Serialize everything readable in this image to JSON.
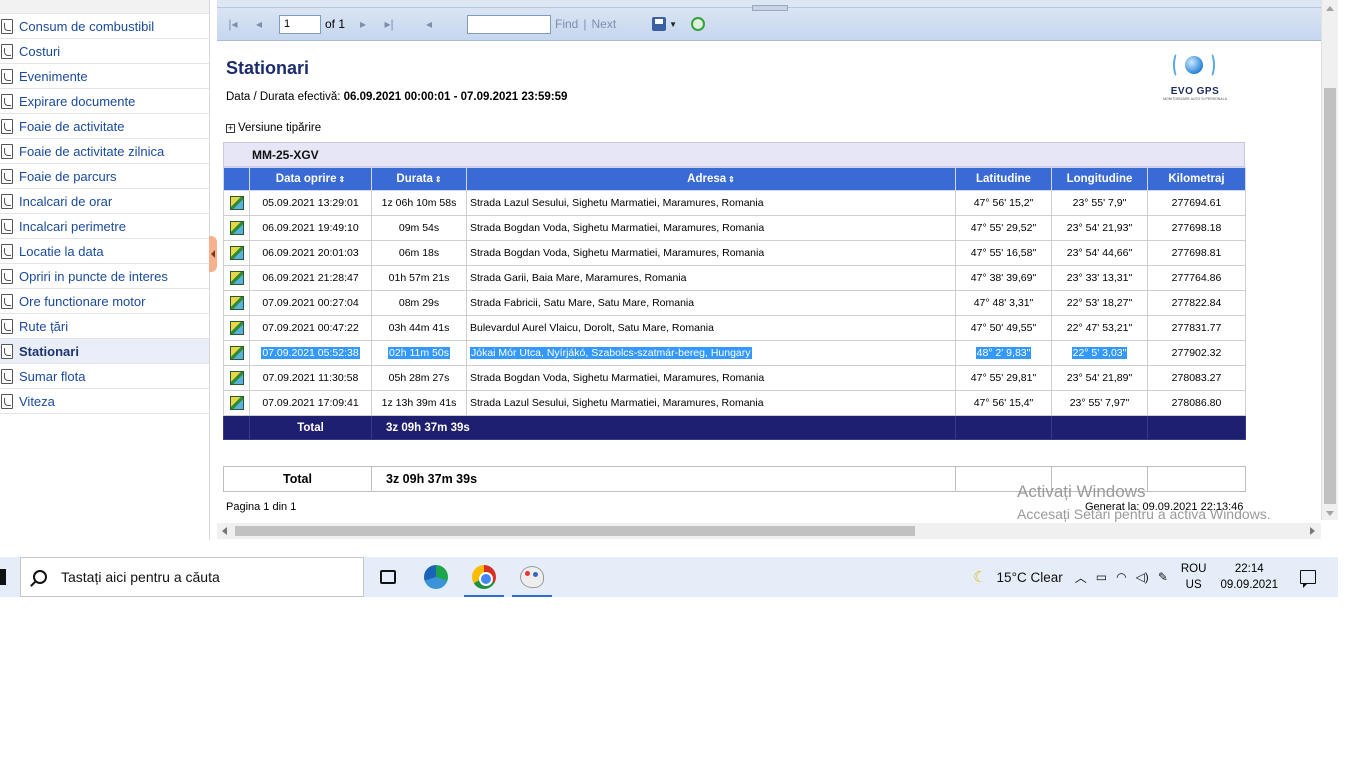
{
  "sidebar": {
    "items": [
      {
        "label": "Consum de combustibil"
      },
      {
        "label": "Costuri"
      },
      {
        "label": "Evenimente"
      },
      {
        "label": "Expirare documente"
      },
      {
        "label": "Foaie de activitate"
      },
      {
        "label": "Foaie de activitate zilnica"
      },
      {
        "label": "Foaie de parcurs"
      },
      {
        "label": "Incalcari de orar"
      },
      {
        "label": "Incalcari perimetre"
      },
      {
        "label": "Locatie la data"
      },
      {
        "label": "Opriri in puncte de interes"
      },
      {
        "label": "Ore functionare motor"
      },
      {
        "label": "Rute țări"
      },
      {
        "label": "Stationari",
        "active": true
      },
      {
        "label": "Sumar flota"
      },
      {
        "label": "Viteza"
      }
    ]
  },
  "toolbar": {
    "page_value": "1",
    "of_label": "of 1",
    "find_value": "",
    "find_label": "Find",
    "separator": "|",
    "next_label": "Next"
  },
  "report": {
    "title": "Stationari",
    "subtitle_prefix": "Data / Durata efectivă:",
    "subtitle_range": "06.09.2021 00:00:01 - 07.09.2021 23:59:59",
    "print_toggle": "Versiune tipărire",
    "logo_text": "EVO GPS",
    "logo_sub": "MONITORIZARE AUTO SI PERSONALA",
    "vehicle": "MM-25-XGV",
    "columns": [
      "Data oprire",
      "Durata",
      "Adresa",
      "Latitudine",
      "Longitudine",
      "Kilometraj"
    ],
    "rows": [
      {
        "date": "05.09.2021 13:29:01",
        "duration": "1z 06h 10m 58s",
        "address": "Strada Lazul Sesului,   Sighetu Marmatiei, Maramures, Romania",
        "lat": "47° 56' 15,2\"",
        "lon": "23° 55' 7,9\"",
        "km": "277694.61"
      },
      {
        "date": "06.09.2021 19:49:10",
        "duration": "09m 54s",
        "address": "Strada Bogdan Voda,   Sighetu Marmatiei, Maramures, Romania",
        "lat": "47° 55' 29,52\"",
        "lon": "23° 54' 21,93\"",
        "km": "277698.18"
      },
      {
        "date": "06.09.2021 20:01:03",
        "duration": "06m 18s",
        "address": "Strada Bogdan Voda,   Sighetu Marmatiei, Maramures, Romania",
        "lat": "47° 55' 16,58\"",
        "lon": "23° 54' 44,66\"",
        "km": "277698.81"
      },
      {
        "date": "06.09.2021 21:28:47",
        "duration": "01h 57m 21s",
        "address": "Strada Garii,   Baia Mare, Maramures, Romania",
        "lat": "47° 38' 39,69\"",
        "lon": "23° 33' 13,31\"",
        "km": "277764.86"
      },
      {
        "date": "07.09.2021 00:27:04",
        "duration": "08m 29s",
        "address": "Strada Fabricii,   Satu Mare, Satu Mare, Romania",
        "lat": "47° 48' 3,31\"",
        "lon": "22° 53' 18,27\"",
        "km": "277822.84"
      },
      {
        "date": "07.09.2021 00:47:22",
        "duration": "03h 44m 41s",
        "address": "Bulevardul Aurel Vlaicu,   Dorolt, Satu Mare, Romania",
        "lat": "47° 50' 49,55\"",
        "lon": "22° 47' 53,21\"",
        "km": "277831.77"
      },
      {
        "date": "07.09.2021 05:52:38",
        "duration": "02h 11m 50s",
        "address": "Jókai Mór Utca,   Nyírjákó, Szabolcs-szatmár-bereg, Hungary",
        "lat": "48° 2' 9,83\"",
        "lon": "22° 5' 3,03\"",
        "km": "277902.32",
        "selected": true
      },
      {
        "date": "07.09.2021 11:30:58",
        "duration": "05h 28m 27s",
        "address": "Strada Bogdan Voda,   Sighetu Marmatiei, Maramures, Romania",
        "lat": "47° 55' 29,81\"",
        "lon": "23° 54' 21,89\"",
        "km": "278083.27"
      },
      {
        "date": "07.09.2021 17:09:41",
        "duration": "1z 13h 39m 41s",
        "address": "Strada Lazul Sesului,   Sighetu Marmatiei, Maramures, Romania",
        "lat": "47° 56' 15,4\"",
        "lon": "23° 55' 7,97\"",
        "km": "278086.80"
      }
    ],
    "total_label": "Total",
    "total_value": "3z 09h 37m 39s",
    "grand_total_label": "Total",
    "grand_total_value": "3z 09h 37m 39s",
    "page_info": "Pagina 1 din 1",
    "generated": "Generat la: 09.09.2021 22:13:46"
  },
  "watermark": {
    "line1": "Activați Windows",
    "line2": "Accesați Setări pentru a activa Windows."
  },
  "taskbar": {
    "search_placeholder": "Tastați aici pentru a căuta",
    "weather": "15°C  Clear",
    "lang_top": "ROU",
    "lang_bottom": "US",
    "time": "22:14",
    "date": "09.09.2021"
  },
  "colors": {
    "header_blue": "#3a6ad6",
    "total_navy": "#1e1f6e",
    "title_navy": "#1c2c6e",
    "selection": "#3399ff"
  }
}
